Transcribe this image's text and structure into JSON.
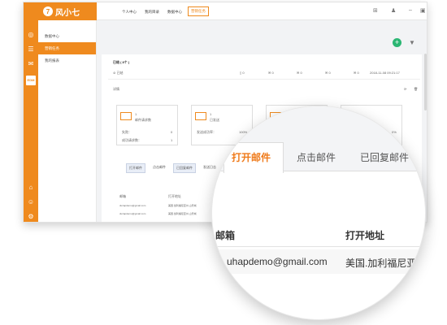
{
  "app": {
    "brand": "风小七"
  },
  "sidebar": {
    "items": [
      {
        "label": "数据中心",
        "active": false
      },
      {
        "label": "营销任务",
        "active": true
      },
      {
        "label": "我的报表",
        "active": false
      }
    ]
  },
  "rail": {
    "icons": [
      "dashboard-icon",
      "list-icon",
      "mail-icon",
      "edm-icon",
      "home-icon",
      "user-icon",
      "settings-icon"
    ],
    "edm_label": "EDM"
  },
  "topbar": {
    "tabs": [
      {
        "label": "个人中心",
        "active": false
      },
      {
        "label": "我的目录",
        "active": false
      },
      {
        "label": "数据中心",
        "active": false
      },
      {
        "label": "营销任务",
        "active": true
      }
    ]
  },
  "task": {
    "title": "已结 ( 8个 )",
    "status": "已结",
    "counts": [
      "0",
      "0",
      "0",
      "0",
      "0"
    ],
    "datetime": "2018-11-08 09:21:17",
    "section": "详情"
  },
  "cards": [
    {
      "count": "1",
      "label": "邮件请求数",
      "r1_label": "失败：",
      "r1_value": "0",
      "r2_label": "成功请求数：",
      "r2_value": "1"
    },
    {
      "count": "1",
      "label": "已发送",
      "r1_label": "发送成功率：",
      "r1_value": "100%"
    },
    {
      "count": "",
      "label": "",
      "r1_label": "",
      "r1_value": ""
    },
    {
      "count": "",
      "label": "",
      "r1_label": "",
      "r1_value": "0%"
    }
  ],
  "subtabs": [
    {
      "label": "打开邮件",
      "active": true
    },
    {
      "label": "点击邮件",
      "active": false
    },
    {
      "label": "已回复邮件",
      "active": false
    },
    {
      "label": "发送日志",
      "active": false
    }
  ],
  "table": {
    "headers": [
      "邮箱",
      "打开地址"
    ],
    "rows": [
      [
        "duzapdemo@gmail.com",
        "美国.加利福尼亚州.山景城"
      ],
      [
        "duzapdemo@gmail.com",
        "美国.加利福尼亚州.山景城"
      ]
    ]
  },
  "zoom": {
    "tabs": [
      {
        "label": "打开邮件",
        "active": true
      },
      {
        "label": "点击邮件",
        "active": false
      },
      {
        "label": "已回复邮件",
        "active": false
      }
    ],
    "headers": [
      "邮箱",
      "打开地址"
    ],
    "row": [
      "uhapdemo@gmail.com",
      "美国.加利福尼亚州"
    ]
  },
  "colors": {
    "brand": "#ef8a1e",
    "accent_green": "#2bb673"
  }
}
